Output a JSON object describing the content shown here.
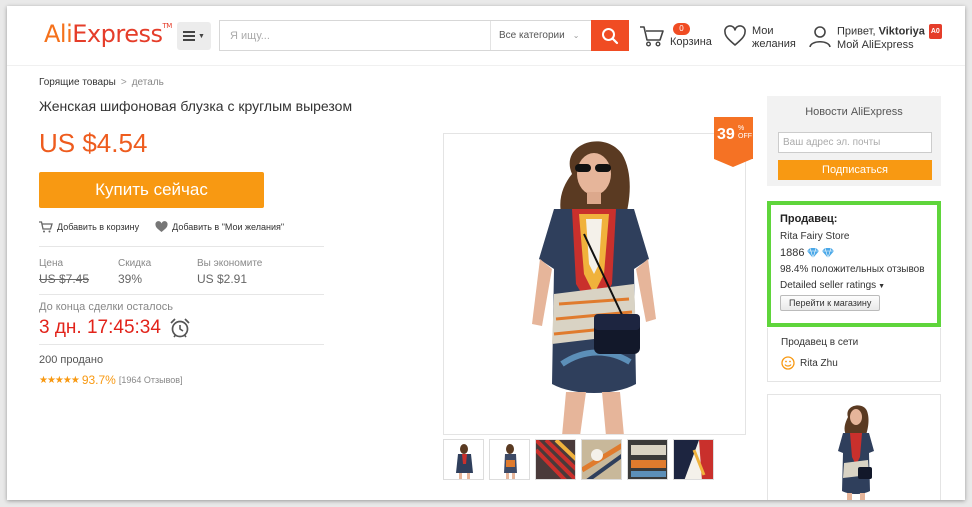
{
  "header": {
    "logo_part1": "Ali",
    "logo_part2": "Express",
    "logo_tm": "TM",
    "search_placeholder": "Я ищу...",
    "category": "Все категории",
    "cart_count": "0",
    "cart_label": "Корзина",
    "wishlist_line1": "Мои",
    "wishlist_line2": "желания",
    "greeting": "Привет,",
    "user_name": "Viktoriya",
    "user_badge": "A0",
    "my_account": "Мой AliExpress"
  },
  "breadcrumb": {
    "item1": "Горящие товары",
    "separator": ">",
    "item2": "деталь"
  },
  "product": {
    "title": "Женская шифоновая блузка с круглым вырезом",
    "price": "US $4.54",
    "buy_label": "Купить сейчас",
    "add_to_cart": "Добавить в корзину",
    "add_to_wishlist": "Добавить в \"Мои желания\"",
    "stat_price_label": "Цена",
    "stat_price_value": "US $7.45",
    "stat_discount_label": "Скидка",
    "stat_discount_value": "39%",
    "stat_save_label": "Вы экономите",
    "stat_save_value": "US $2.91",
    "deal_label": "До конца сделки осталось",
    "countdown": "3 дн. 17:45:34",
    "sold": "200 продано",
    "rating_pct": "93.7%",
    "rating_count": "[1964 Отзывов]",
    "discount_badge_number": "39",
    "discount_badge_pct": "%",
    "discount_badge_off": "OFF"
  },
  "newsletter": {
    "title": "Новости AliExpress",
    "email_placeholder": "Ваш адрес эл. почты",
    "subscribe": "Подписаться"
  },
  "seller": {
    "heading": "Продавец:",
    "store_name": "Rita Fairy Store",
    "score": "1886",
    "positive": "98.4% положительных отзывов",
    "detailed": "Detailed seller ratings",
    "go_to_store": "Перейти к магазину"
  },
  "online": {
    "heading": "Продавец в сети",
    "name": "Rita Zhu"
  },
  "colors": {
    "accent_orange": "#f89912",
    "price_orange": "#ee5c1e",
    "search_red": "#f04c23",
    "timer_red": "#e2231a",
    "seller_highlight": "#5fd53b"
  },
  "icons": [
    "menu-icon",
    "search-icon",
    "cart-icon",
    "heart-icon",
    "user-icon",
    "alarm-clock-icon",
    "diamond-icon",
    "smiley-icon"
  ]
}
